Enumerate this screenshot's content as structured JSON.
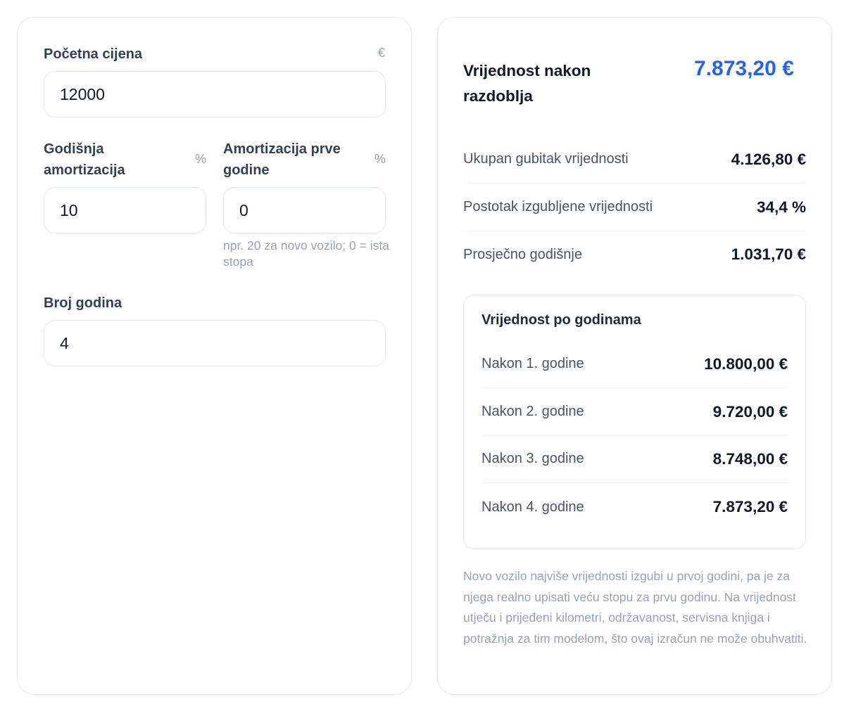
{
  "inputs": {
    "price": {
      "label": "Početna cijena",
      "unit": "€",
      "value": "12000"
    },
    "annual": {
      "label": "Godišnja amortizacija",
      "unit": "%",
      "value": "10"
    },
    "first_year": {
      "label": "Amortizacija prve godine",
      "unit": "%",
      "value": "0",
      "hint": "npr. 20 za novo vozilo; 0 = ista stopa"
    },
    "years": {
      "label": "Broj godina",
      "value": "4"
    }
  },
  "results": {
    "headline_label": "Vrijednost nakon razdoblja",
    "headline_value": "7.873,20 €",
    "stats": [
      {
        "label": "Ukupan gubitak vrijednosti",
        "value": "4.126,80 €"
      },
      {
        "label": "Postotak izgubljene vrijednosti",
        "value": "34,4 %"
      },
      {
        "label": "Prosječno godišnje",
        "value": "1.031,70 €"
      }
    ],
    "by_year": {
      "title": "Vrijednost po godinama",
      "rows": [
        {
          "label": "Nakon 1. godine",
          "value": "10.800,00 €"
        },
        {
          "label": "Nakon 2. godine",
          "value": "9.720,00 €"
        },
        {
          "label": "Nakon 3. godine",
          "value": "8.748,00 €"
        },
        {
          "label": "Nakon 4. godine",
          "value": "7.873,20 €"
        }
      ]
    },
    "note": "Novo vozilo najviše vrijednosti izgubi u prvoj godini, pa je za njega realno upisati veću stopu za prvu godinu. Na vrijednost utječu i prijeđeni kilometri, održavanost, servisna knjiga i potražnja za tim modelom, što ovaj izračun ne može obuhvatiti."
  },
  "colors": {
    "accent": "#2563eb",
    "muted": "#94a3b8",
    "border": "#e5e7eb"
  }
}
